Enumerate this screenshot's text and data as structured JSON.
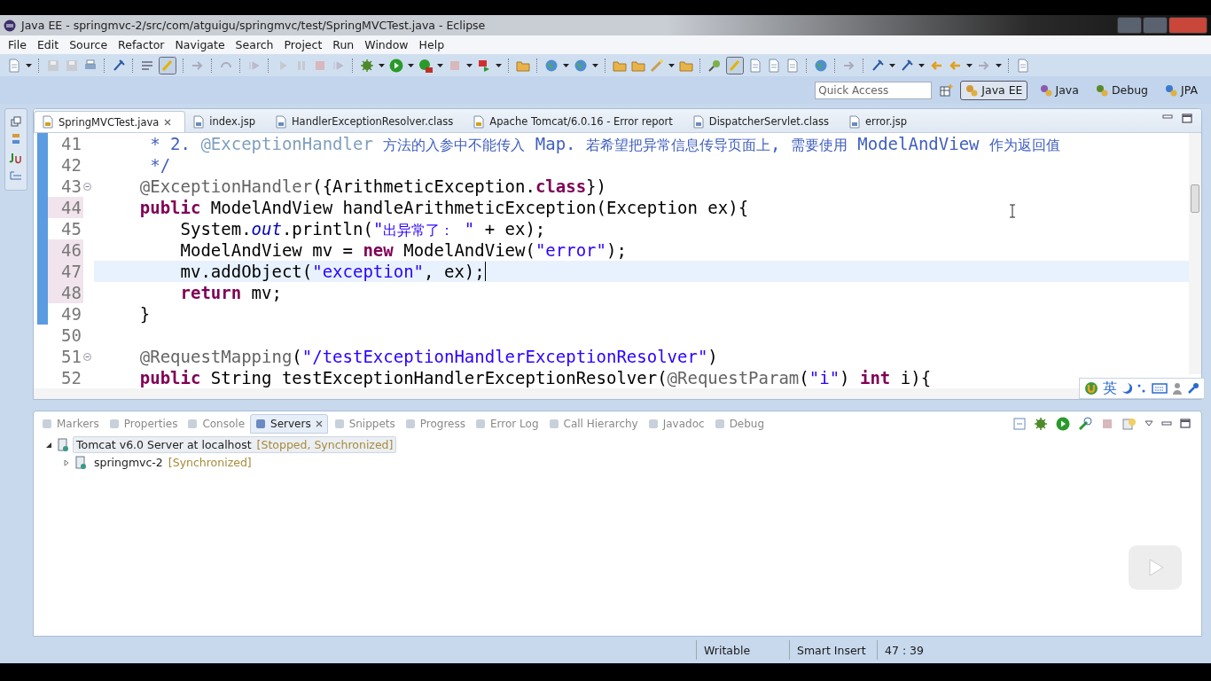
{
  "window": {
    "title": "Java EE - springmvc-2/src/com/atguigu/springmvc/test/SpringMVCTest.java - Eclipse"
  },
  "menu": [
    "File",
    "Edit",
    "Source",
    "Refactor",
    "Navigate",
    "Search",
    "Project",
    "Run",
    "Window",
    "Help"
  ],
  "quick_access": {
    "placeholder": "Quick Access"
  },
  "perspectives": [
    {
      "label": "Java EE",
      "selected": true
    },
    {
      "label": "Java",
      "selected": false
    },
    {
      "label": "Debug",
      "selected": false
    },
    {
      "label": "JPA",
      "selected": false
    }
  ],
  "editor": {
    "tabs": [
      {
        "label": "SpringMVCTest.java",
        "selected": true
      },
      {
        "label": "index.jsp",
        "selected": false
      },
      {
        "label": "HandlerExceptionResolver.class",
        "selected": false
      },
      {
        "label": "Apache Tomcat/6.0.16 - Error report",
        "selected": false
      },
      {
        "label": "DispatcherServlet.class",
        "selected": false
      },
      {
        "label": "error.jsp",
        "selected": false
      }
    ],
    "lines": [
      {
        "number": "41",
        "range": true,
        "changed": false,
        "current": false,
        "fold": false,
        "tokens": [
          {
            "kind": "comment",
            "text": "     * 2. "
          },
          {
            "kind": "doctag",
            "text": "@ExceptionHandler"
          },
          {
            "kind": "comment",
            "text": " 方法的入参中不能传入 Map. 若希望把异常信息传导页面上, 需要使用 ModelAndView 作为返回值"
          }
        ]
      },
      {
        "number": "42",
        "range": true,
        "changed": false,
        "current": false,
        "fold": false,
        "tokens": [
          {
            "kind": "comment",
            "text": "     */"
          }
        ]
      },
      {
        "number": "43",
        "range": true,
        "changed": false,
        "current": false,
        "fold": true,
        "tokens": [
          {
            "kind": "annotation",
            "text": "    @ExceptionHandler"
          },
          {
            "kind": "plain",
            "text": "({ArithmeticException."
          },
          {
            "kind": "keyword",
            "text": "class"
          },
          {
            "kind": "plain",
            "text": "})"
          }
        ]
      },
      {
        "number": "44",
        "range": true,
        "changed": true,
        "current": false,
        "fold": false,
        "tokens": [
          {
            "kind": "keyword",
            "text": "    public"
          },
          {
            "kind": "plain",
            "text": " ModelAndView handleArithmeticException(Exception ex){"
          }
        ]
      },
      {
        "number": "45",
        "range": true,
        "changed": false,
        "current": false,
        "fold": false,
        "tokens": [
          {
            "kind": "plain",
            "text": "        System."
          },
          {
            "kind": "field",
            "text": "out"
          },
          {
            "kind": "plain",
            "text": ".println("
          },
          {
            "kind": "string",
            "text": "\"出异常了： \""
          },
          {
            "kind": "plain",
            "text": " + ex);"
          }
        ]
      },
      {
        "number": "46",
        "range": true,
        "changed": true,
        "current": false,
        "fold": false,
        "tokens": [
          {
            "kind": "plain",
            "text": "        ModelAndView mv = "
          },
          {
            "kind": "keyword",
            "text": "new"
          },
          {
            "kind": "plain",
            "text": " ModelAndView("
          },
          {
            "kind": "string",
            "text": "\"error\""
          },
          {
            "kind": "plain",
            "text": ");"
          }
        ]
      },
      {
        "number": "47",
        "range": true,
        "changed": true,
        "current": true,
        "fold": false,
        "tokens": [
          {
            "kind": "plain",
            "text": "        mv.addObject("
          },
          {
            "kind": "string",
            "text": "\"exception\""
          },
          {
            "kind": "plain",
            "text": ", ex);"
          }
        ]
      },
      {
        "number": "48",
        "range": true,
        "changed": true,
        "current": false,
        "fold": false,
        "tokens": [
          {
            "kind": "keyword",
            "text": "        return"
          },
          {
            "kind": "plain",
            "text": " mv;"
          }
        ]
      },
      {
        "number": "49",
        "range": true,
        "changed": false,
        "current": false,
        "fold": false,
        "tokens": [
          {
            "kind": "plain",
            "text": "    }"
          }
        ]
      },
      {
        "number": "50",
        "range": false,
        "changed": false,
        "current": false,
        "fold": false
      },
      {
        "number": "51",
        "range": false,
        "changed": false,
        "current": false,
        "fold": true,
        "tokens": [
          {
            "kind": "annotation",
            "text": "    @RequestMapping"
          },
          {
            "kind": "plain",
            "text": "("
          },
          {
            "kind": "string",
            "text": "\"/testExceptionHandlerExceptionResolver\""
          },
          {
            "kind": "plain",
            "text": ")"
          }
        ]
      },
      {
        "number": "52",
        "range": false,
        "changed": false,
        "current": false,
        "fold": false,
        "tokens": [
          {
            "kind": "keyword",
            "text": "    public"
          },
          {
            "kind": "plain",
            "text": " String testExceptionHandlerExceptionResolver("
          },
          {
            "kind": "annotation",
            "text": "@RequestParam"
          },
          {
            "kind": "plain",
            "text": "("
          },
          {
            "kind": "string",
            "text": "\"i\""
          },
          {
            "kind": "plain",
            "text": ") "
          },
          {
            "kind": "keyword",
            "text": "int"
          },
          {
            "kind": "plain",
            "text": " i){"
          }
        ]
      }
    ]
  },
  "ime_bar": {
    "label": "英"
  },
  "bottom_panel": {
    "tabs": [
      {
        "label": "Markers",
        "selected": false
      },
      {
        "label": "Properties",
        "selected": false
      },
      {
        "label": "Console",
        "selected": false
      },
      {
        "label": "Servers",
        "selected": true
      },
      {
        "label": "Snippets",
        "selected": false
      },
      {
        "label": "Progress",
        "selected": false
      },
      {
        "label": "Error Log",
        "selected": false
      },
      {
        "label": "Call Hierarchy",
        "selected": false
      },
      {
        "label": "Javadoc",
        "selected": false
      },
      {
        "label": "Debug",
        "selected": false
      }
    ],
    "tree": [
      {
        "label": "Tomcat v6.0 Server at localhost",
        "status": "[Stopped, Synchronized]",
        "expanded": true,
        "selected": true,
        "children": [
          {
            "label": "springmvc-2",
            "status": "[Synchronized]",
            "expanded": false,
            "selected": false
          }
        ]
      }
    ]
  },
  "status_bar": [
    "Writable",
    "Smart Insert",
    "47 : 39"
  ]
}
